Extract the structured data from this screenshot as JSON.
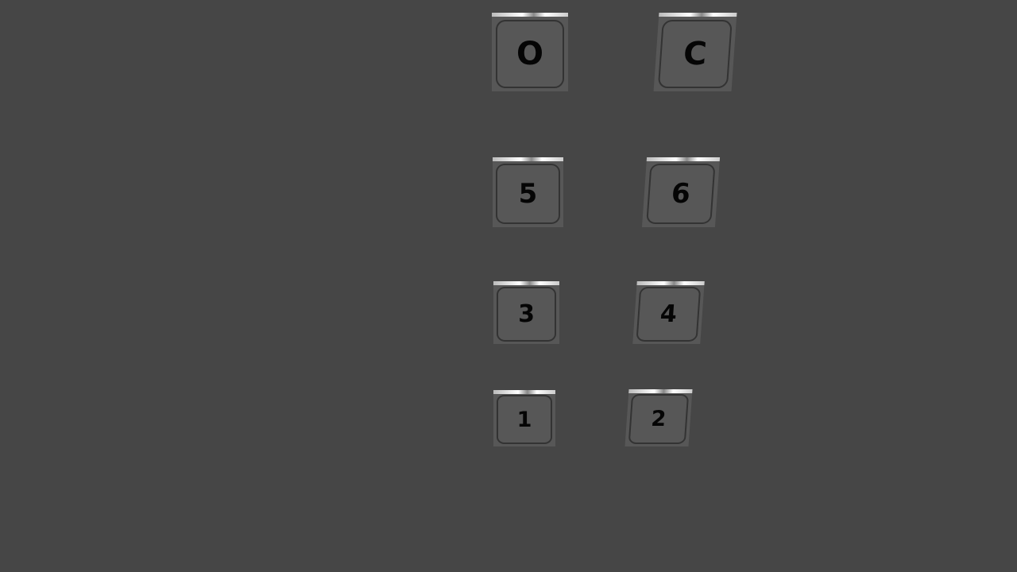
{
  "panel": {
    "buttons": [
      {
        "label": "O",
        "action": "open-doors"
      },
      {
        "label": "C",
        "action": "close-doors"
      },
      {
        "label": "5"
      },
      {
        "label": "6"
      },
      {
        "label": "3"
      },
      {
        "label": "4"
      },
      {
        "label": "1"
      },
      {
        "label": "2"
      }
    ]
  },
  "colors": {
    "background": "#464646",
    "button_face": "#575757",
    "label": "#050505"
  }
}
